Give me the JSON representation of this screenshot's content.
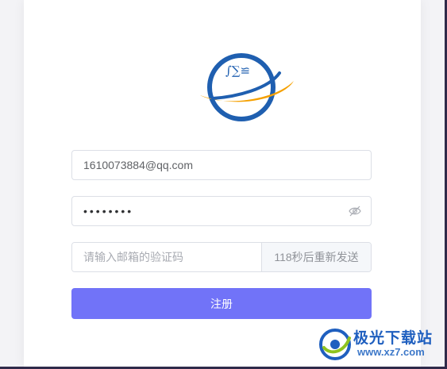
{
  "login_form": {
    "logo_symbols": "∫∑≌",
    "email_value": "1610073884@qq.com",
    "password_value": "••••••••",
    "code_placeholder": "请输入邮箱的验证码",
    "resend_label": "118秒后重新发送",
    "register_label": "注册"
  },
  "watermark": {
    "name": "极光下载站",
    "url": "www.xz7.com"
  },
  "colors": {
    "accent": "#7173f8",
    "logo_blue": "#1f5fb0",
    "logo_orange": "#f5a000"
  },
  "icons": {
    "password_toggle": "eye-off-icon"
  }
}
